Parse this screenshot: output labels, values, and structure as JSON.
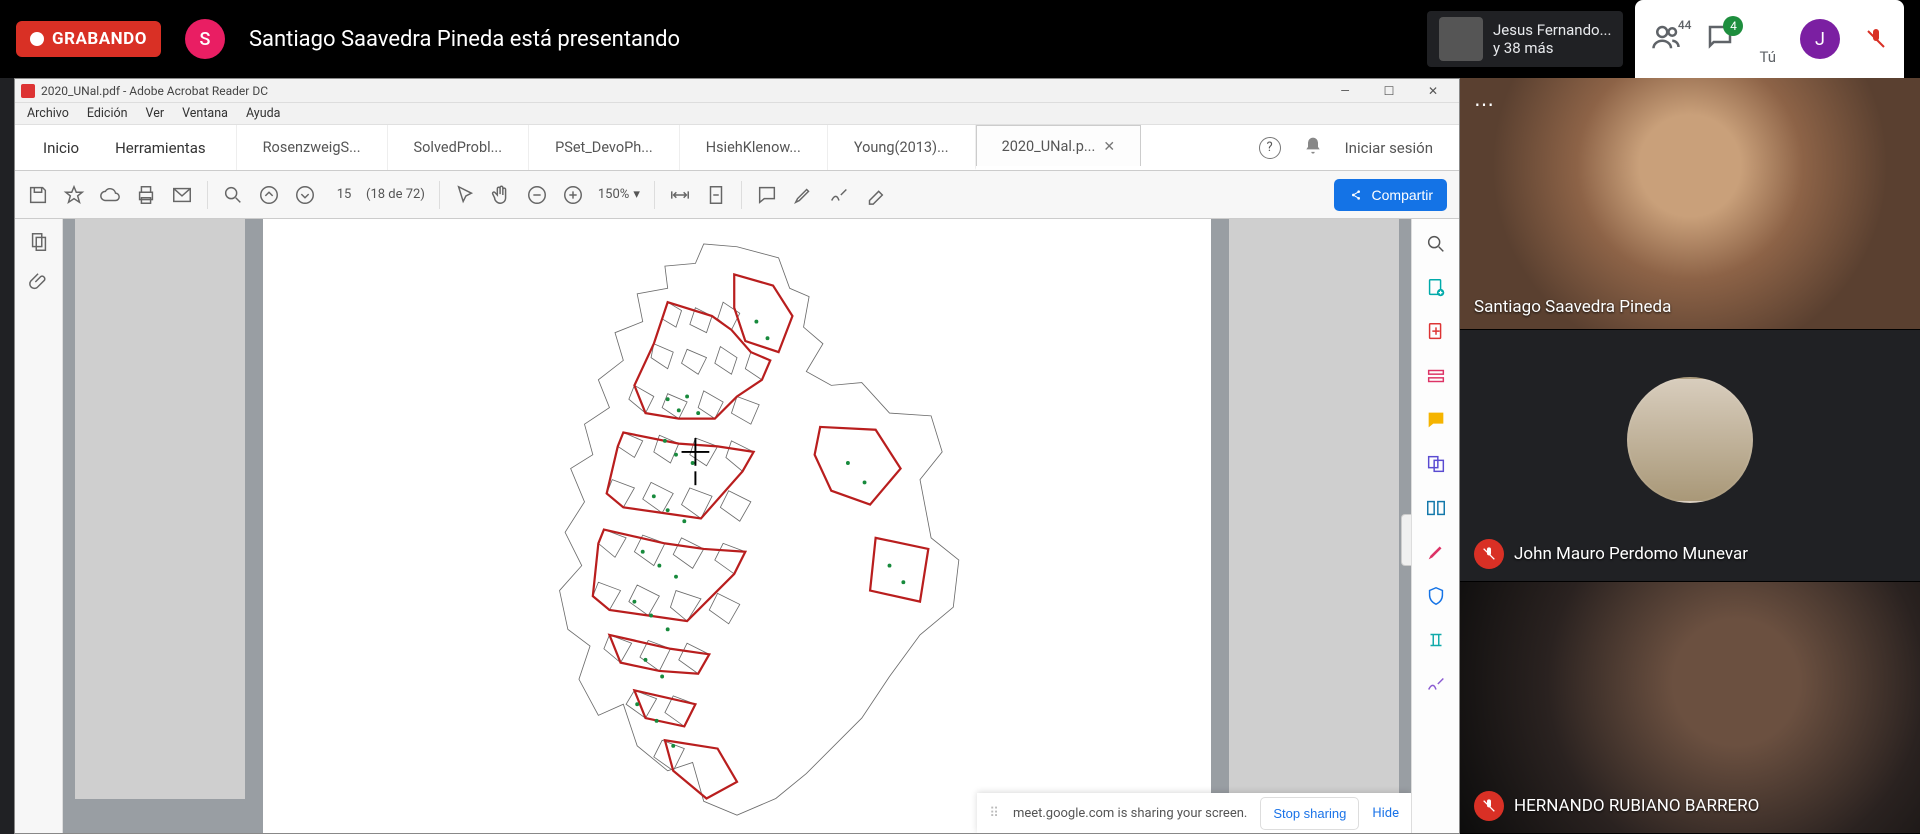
{
  "meet": {
    "recording_label": "GRABANDO",
    "presenter_initial": "S",
    "presenting_text": "Santiago Saavedra Pineda está presentando",
    "participant_name": "Jesus Fernando...",
    "participant_more": "y 38 más",
    "people_count": "44",
    "chat_count": "4",
    "you_label": "Tú",
    "you_initial": "J"
  },
  "acrobat": {
    "title": "2020_UNal.pdf - Adobe Acrobat Reader DC",
    "menus": [
      "Archivo",
      "Edición",
      "Ver",
      "Ventana",
      "Ayuda"
    ],
    "home": "Inicio",
    "tools": "Herramientas",
    "tabs": [
      "RosenzweigS...",
      "SolvedProbl...",
      "PSet_DevoPh...",
      "HsiehKlenow...",
      "Young(2013)...",
      "2020_UNal.p..."
    ],
    "active_tab_index": 5,
    "signin": "Iniciar sesión",
    "page_current": "15",
    "page_total_label": "(18 de 72)",
    "zoom": "150%",
    "share_button": "Compartir"
  },
  "share_notif": {
    "text": "meet.google.com is sharing your screen.",
    "stop": "Stop sharing",
    "hide": "Hide"
  },
  "participants": {
    "p1": "Santiago Saavedra Pineda",
    "p2": "John Mauro Perdomo Munevar",
    "p3": "HERNANDO RUBIANO BARRERO"
  }
}
